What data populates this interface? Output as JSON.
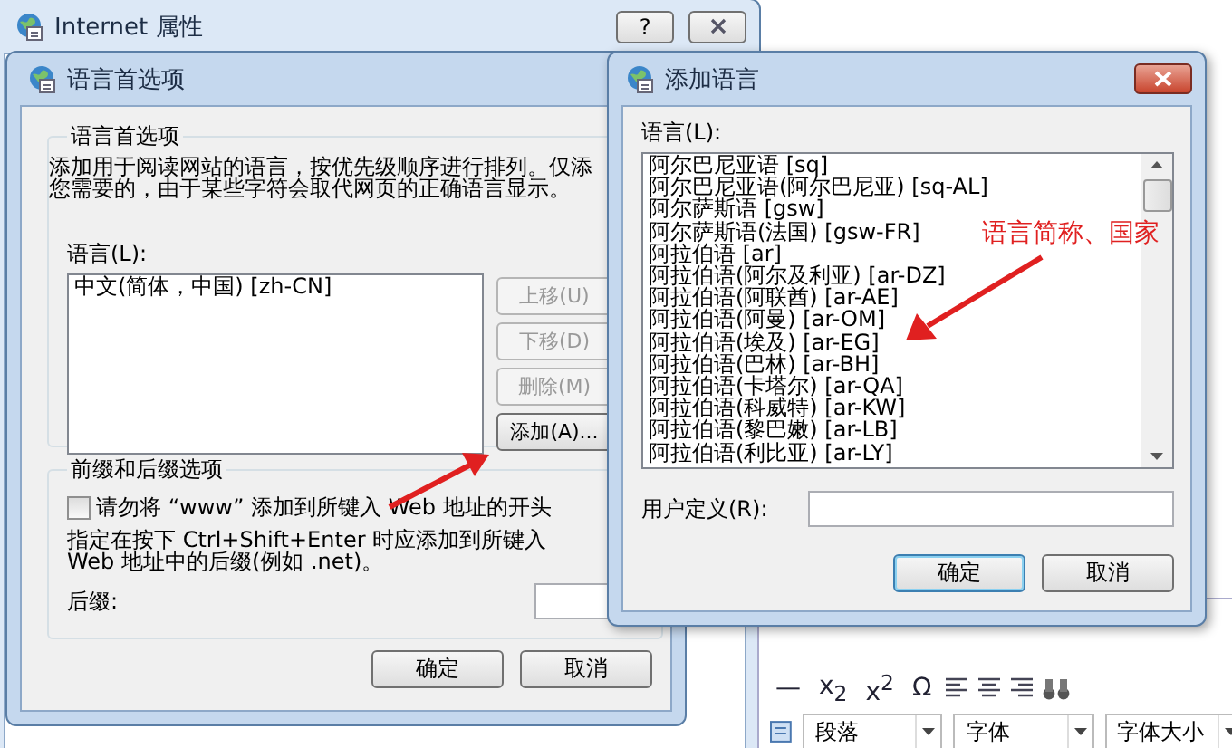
{
  "properties_window": {
    "title": "Internet 属性",
    "help_button": "?"
  },
  "language_preferences": {
    "title": "语言首选项",
    "group_title": "语言首选项",
    "description": [
      "添加用于阅读网站的语言，按优先级顺序进行排列。仅添",
      "您需要的，由于某些字符会取代网页的正确语言显示。"
    ],
    "list_label": "语言(L):",
    "languages": [
      {
        "label": "中文(简体，中国) [zh-CN]",
        "selected": false
      }
    ],
    "side_buttons": [
      {
        "label": "上移(U)",
        "disabled": true
      },
      {
        "label": "下移(D)",
        "disabled": true
      },
      {
        "label": "删除(M)",
        "disabled": true
      },
      {
        "label": "添加(A)...",
        "disabled": false
      }
    ],
    "suffix_group_title": "前缀和后缀选项",
    "www_checkbox": {
      "label": "请勿将 “www” 添加到所键入 Web 地址的开头",
      "checked": false
    },
    "suffix_note": "指定在按下 Ctrl+Shift+Enter 时应添加到所键入 Web 地址中的后缀(例如 .net)。",
    "suffix_label": "后缀:",
    "buttons": [
      "确定",
      "取消"
    ]
  },
  "add_language": {
    "title": "添加语言",
    "list_label": "语言(L):",
    "languages": [
      {
        "label": "阿尔巴尼亚语 [sq]",
        "selected": false
      },
      {
        "label": "阿尔巴尼亚语(阿尔巴尼亚) [sq-AL]",
        "selected": false
      },
      {
        "label": "阿尔萨斯语 [gsw]",
        "selected": false
      },
      {
        "label": "阿尔萨斯语(法国) [gsw-FR]",
        "selected": false
      },
      {
        "label": "阿拉伯语 [ar]",
        "selected": false
      },
      {
        "label": "阿拉伯语(阿尔及利亚) [ar-DZ]",
        "selected": false
      },
      {
        "label": "阿拉伯语(阿联酋) [ar-AE]",
        "selected": false
      },
      {
        "label": "阿拉伯语(阿曼) [ar-OM]",
        "selected": false
      },
      {
        "label": "阿拉伯语(埃及) [ar-EG]",
        "selected": false
      },
      {
        "label": "阿拉伯语(巴林) [ar-BH]",
        "selected": false
      },
      {
        "label": "阿拉伯语(卡塔尔) [ar-QA]",
        "selected": false
      },
      {
        "label": "阿拉伯语(科威特) [ar-KW]",
        "selected": false
      },
      {
        "label": "阿拉伯语(黎巴嫩) [ar-LB]",
        "selected": false
      },
      {
        "label": "阿拉伯语(利比亚) [ar-LY]",
        "selected": false
      }
    ],
    "custom_label": "用户定义(R):",
    "buttons": [
      {
        "label": "确定",
        "default": true
      },
      {
        "label": "取消",
        "default": false
      }
    ]
  },
  "annotation": {
    "text": "语言简称、国家"
  },
  "editor_toolbar": {
    "buttons": [
      "—",
      "x$_{2}$",
      "x$^{2}$",
      "Ω"
    ],
    "dropdowns": [
      "段落",
      "字体",
      "字体大小"
    ]
  }
}
